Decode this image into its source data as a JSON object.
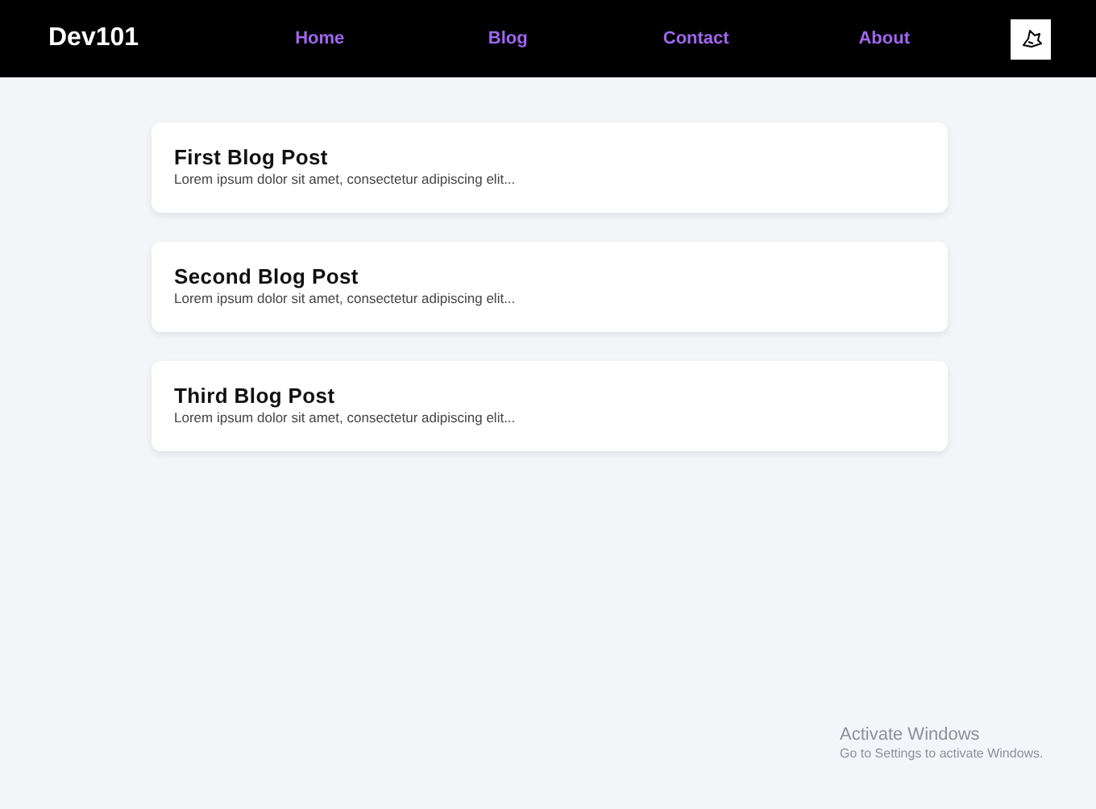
{
  "header": {
    "logo": "Dev101",
    "nav": [
      {
        "label": "Home"
      },
      {
        "label": "Blog"
      },
      {
        "label": "Contact"
      },
      {
        "label": "About"
      }
    ]
  },
  "posts": [
    {
      "title": "First Blog Post",
      "excerpt": "Lorem ipsum dolor sit amet, consectetur adipiscing elit..."
    },
    {
      "title": "Second Blog Post",
      "excerpt": "Lorem ipsum dolor sit amet, consectetur adipiscing elit..."
    },
    {
      "title": "Third Blog Post",
      "excerpt": "Lorem ipsum dolor sit amet, consectetur adipiscing elit..."
    }
  ],
  "activation_notice": {
    "title": "Activate Windows",
    "message": "Go to Settings to activate Windows."
  }
}
